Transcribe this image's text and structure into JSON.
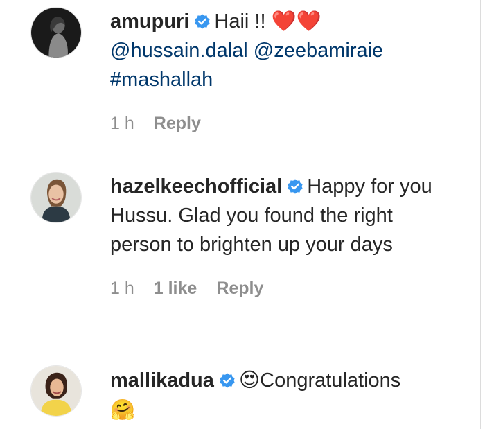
{
  "comments": [
    {
      "username": "amupuri",
      "text": "Haii !! ❤️❤️",
      "mentions": "@hussain.dalal @zeebamiraie",
      "hashtag": "#mashallah",
      "time": "1 h",
      "reply_label": "Reply"
    },
    {
      "username": "hazelkeechofficial",
      "text": "Happy for you Hussu. Glad you found the right person to brighten up your days",
      "time": "1 h",
      "likes": "1 like",
      "reply_label": "Reply"
    },
    {
      "username": "mallikadua",
      "emoji_prefix": "😍",
      "text": "Congratulations",
      "emoji_suffix": "🤗"
    }
  ],
  "colors": {
    "text": "#262626",
    "secondary": "#8e8e8e",
    "mention": "#00376b",
    "verified": "#3897f0"
  }
}
